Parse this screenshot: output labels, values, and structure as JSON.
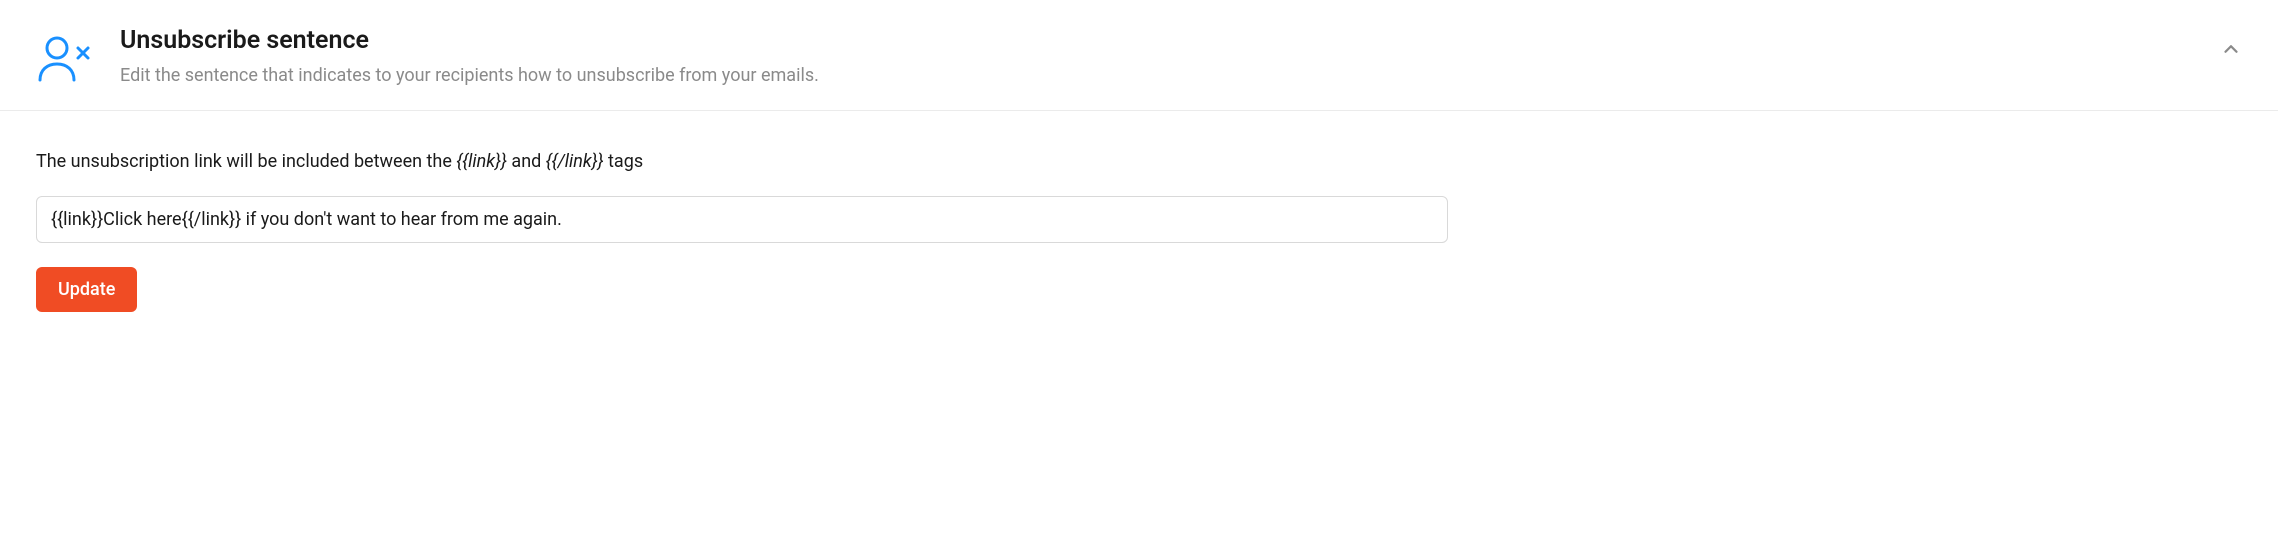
{
  "header": {
    "title": "Unsubscribe sentence",
    "subtitle": "Edit the sentence that indicates to your recipients how to unsubscribe from your emails."
  },
  "body": {
    "help_prefix": "The unsubscription link will be included between the ",
    "tag_open": "{{link}}",
    "help_middle": " and ",
    "tag_close": "{{/link}}",
    "help_suffix": " tags",
    "input_value": "{{link}}Click here{{/link}} if you don't want to hear from me again.",
    "update_label": "Update"
  }
}
